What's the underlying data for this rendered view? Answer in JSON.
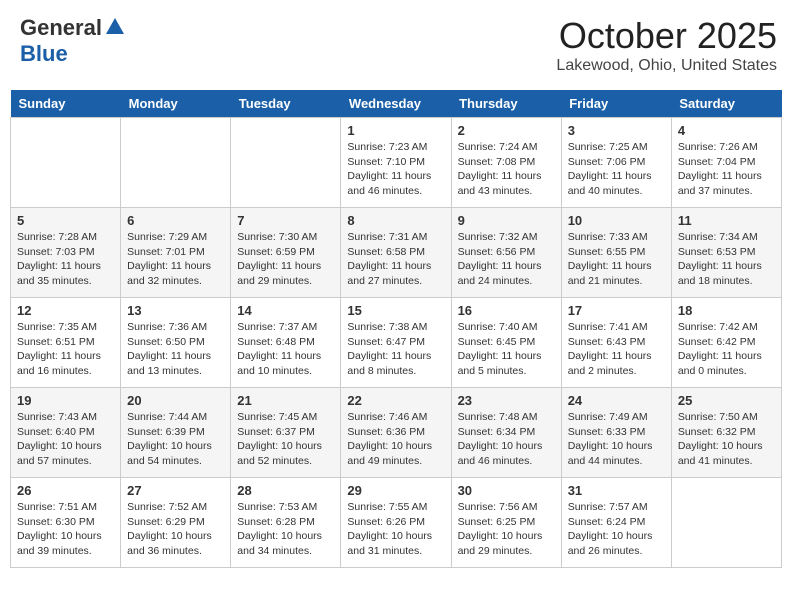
{
  "header": {
    "logo_general": "General",
    "logo_blue": "Blue",
    "month": "October 2025",
    "location": "Lakewood, Ohio, United States"
  },
  "days_of_week": [
    "Sunday",
    "Monday",
    "Tuesday",
    "Wednesday",
    "Thursday",
    "Friday",
    "Saturday"
  ],
  "weeks": [
    [
      {
        "num": "",
        "info": ""
      },
      {
        "num": "",
        "info": ""
      },
      {
        "num": "",
        "info": ""
      },
      {
        "num": "1",
        "info": "Sunrise: 7:23 AM\nSunset: 7:10 PM\nDaylight: 11 hours and 46 minutes."
      },
      {
        "num": "2",
        "info": "Sunrise: 7:24 AM\nSunset: 7:08 PM\nDaylight: 11 hours and 43 minutes."
      },
      {
        "num": "3",
        "info": "Sunrise: 7:25 AM\nSunset: 7:06 PM\nDaylight: 11 hours and 40 minutes."
      },
      {
        "num": "4",
        "info": "Sunrise: 7:26 AM\nSunset: 7:04 PM\nDaylight: 11 hours and 37 minutes."
      }
    ],
    [
      {
        "num": "5",
        "info": "Sunrise: 7:28 AM\nSunset: 7:03 PM\nDaylight: 11 hours and 35 minutes."
      },
      {
        "num": "6",
        "info": "Sunrise: 7:29 AM\nSunset: 7:01 PM\nDaylight: 11 hours and 32 minutes."
      },
      {
        "num": "7",
        "info": "Sunrise: 7:30 AM\nSunset: 6:59 PM\nDaylight: 11 hours and 29 minutes."
      },
      {
        "num": "8",
        "info": "Sunrise: 7:31 AM\nSunset: 6:58 PM\nDaylight: 11 hours and 27 minutes."
      },
      {
        "num": "9",
        "info": "Sunrise: 7:32 AM\nSunset: 6:56 PM\nDaylight: 11 hours and 24 minutes."
      },
      {
        "num": "10",
        "info": "Sunrise: 7:33 AM\nSunset: 6:55 PM\nDaylight: 11 hours and 21 minutes."
      },
      {
        "num": "11",
        "info": "Sunrise: 7:34 AM\nSunset: 6:53 PM\nDaylight: 11 hours and 18 minutes."
      }
    ],
    [
      {
        "num": "12",
        "info": "Sunrise: 7:35 AM\nSunset: 6:51 PM\nDaylight: 11 hours and 16 minutes."
      },
      {
        "num": "13",
        "info": "Sunrise: 7:36 AM\nSunset: 6:50 PM\nDaylight: 11 hours and 13 minutes."
      },
      {
        "num": "14",
        "info": "Sunrise: 7:37 AM\nSunset: 6:48 PM\nDaylight: 11 hours and 10 minutes."
      },
      {
        "num": "15",
        "info": "Sunrise: 7:38 AM\nSunset: 6:47 PM\nDaylight: 11 hours and 8 minutes."
      },
      {
        "num": "16",
        "info": "Sunrise: 7:40 AM\nSunset: 6:45 PM\nDaylight: 11 hours and 5 minutes."
      },
      {
        "num": "17",
        "info": "Sunrise: 7:41 AM\nSunset: 6:43 PM\nDaylight: 11 hours and 2 minutes."
      },
      {
        "num": "18",
        "info": "Sunrise: 7:42 AM\nSunset: 6:42 PM\nDaylight: 11 hours and 0 minutes."
      }
    ],
    [
      {
        "num": "19",
        "info": "Sunrise: 7:43 AM\nSunset: 6:40 PM\nDaylight: 10 hours and 57 minutes."
      },
      {
        "num": "20",
        "info": "Sunrise: 7:44 AM\nSunset: 6:39 PM\nDaylight: 10 hours and 54 minutes."
      },
      {
        "num": "21",
        "info": "Sunrise: 7:45 AM\nSunset: 6:37 PM\nDaylight: 10 hours and 52 minutes."
      },
      {
        "num": "22",
        "info": "Sunrise: 7:46 AM\nSunset: 6:36 PM\nDaylight: 10 hours and 49 minutes."
      },
      {
        "num": "23",
        "info": "Sunrise: 7:48 AM\nSunset: 6:34 PM\nDaylight: 10 hours and 46 minutes."
      },
      {
        "num": "24",
        "info": "Sunrise: 7:49 AM\nSunset: 6:33 PM\nDaylight: 10 hours and 44 minutes."
      },
      {
        "num": "25",
        "info": "Sunrise: 7:50 AM\nSunset: 6:32 PM\nDaylight: 10 hours and 41 minutes."
      }
    ],
    [
      {
        "num": "26",
        "info": "Sunrise: 7:51 AM\nSunset: 6:30 PM\nDaylight: 10 hours and 39 minutes."
      },
      {
        "num": "27",
        "info": "Sunrise: 7:52 AM\nSunset: 6:29 PM\nDaylight: 10 hours and 36 minutes."
      },
      {
        "num": "28",
        "info": "Sunrise: 7:53 AM\nSunset: 6:28 PM\nDaylight: 10 hours and 34 minutes."
      },
      {
        "num": "29",
        "info": "Sunrise: 7:55 AM\nSunset: 6:26 PM\nDaylight: 10 hours and 31 minutes."
      },
      {
        "num": "30",
        "info": "Sunrise: 7:56 AM\nSunset: 6:25 PM\nDaylight: 10 hours and 29 minutes."
      },
      {
        "num": "31",
        "info": "Sunrise: 7:57 AM\nSunset: 6:24 PM\nDaylight: 10 hours and 26 minutes."
      },
      {
        "num": "",
        "info": ""
      }
    ]
  ]
}
